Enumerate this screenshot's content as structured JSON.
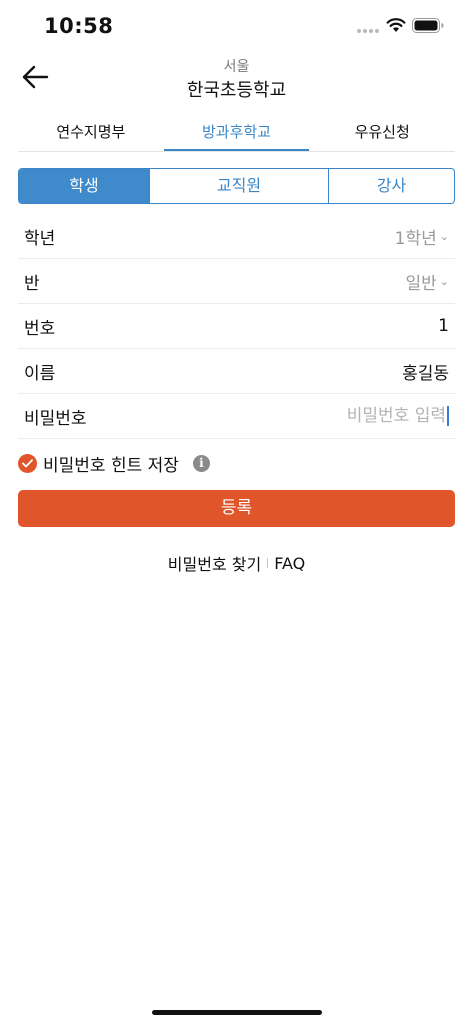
{
  "status_bar": {
    "time": "10:58"
  },
  "header": {
    "region": "서울",
    "title": "한국초등학교"
  },
  "top_tabs": [
    {
      "label": "연수지명부",
      "active": false
    },
    {
      "label": "방과후학교",
      "active": true
    },
    {
      "label": "우유신청",
      "active": false
    }
  ],
  "segments": [
    {
      "label": "학생",
      "active": true
    },
    {
      "label": "교직원",
      "active": false
    },
    {
      "label": "강사",
      "active": false
    }
  ],
  "form": {
    "grade": {
      "label": "학년",
      "value": "1학년"
    },
    "class": {
      "label": "반",
      "value": "일반"
    },
    "number": {
      "label": "번호",
      "value": "1"
    },
    "name": {
      "label": "이름",
      "value": "홍길동"
    },
    "password": {
      "label": "비밀번호",
      "placeholder": "비밀번호 입력",
      "value": ""
    }
  },
  "hint": {
    "label": "비밀번호 힌트 저장",
    "checked": true
  },
  "register_label": "등록",
  "links": {
    "find_password": "비밀번호 찾기",
    "faq": "FAQ"
  },
  "colors": {
    "accent_blue": "#3f8acb",
    "accent_orange": "#e0552a"
  }
}
